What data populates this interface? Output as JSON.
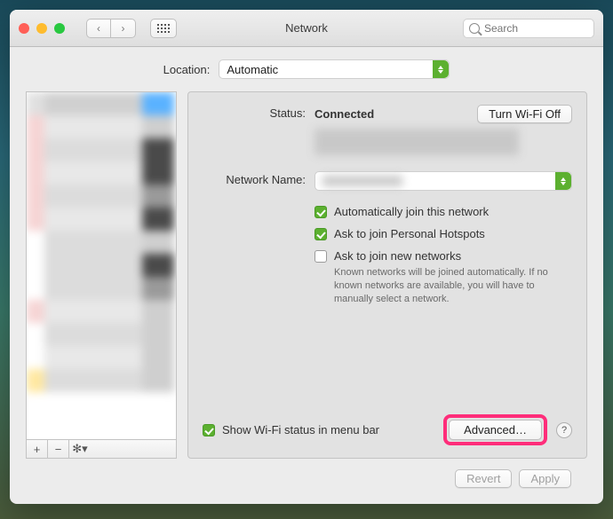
{
  "window": {
    "title": "Network"
  },
  "search": {
    "placeholder": "Search"
  },
  "location": {
    "label": "Location:",
    "value": "Automatic"
  },
  "status": {
    "label": "Status:",
    "value": "Connected",
    "toggle_label": "Turn Wi-Fi Off"
  },
  "network_name": {
    "label": "Network Name:"
  },
  "auto_join": {
    "label": "Automatically join this network",
    "checked": true
  },
  "ask_hotspot": {
    "label": "Ask to join Personal Hotspots",
    "checked": true
  },
  "ask_new": {
    "label": "Ask to join new networks",
    "checked": false,
    "hint": "Known networks will be joined automatically. If no known networks are available, you will have to manually select a network."
  },
  "show_menu": {
    "label": "Show Wi-Fi status in menu bar",
    "checked": true
  },
  "advanced_button": "Advanced…",
  "revert_button": "Revert",
  "apply_button": "Apply",
  "help_tooltip": "?"
}
